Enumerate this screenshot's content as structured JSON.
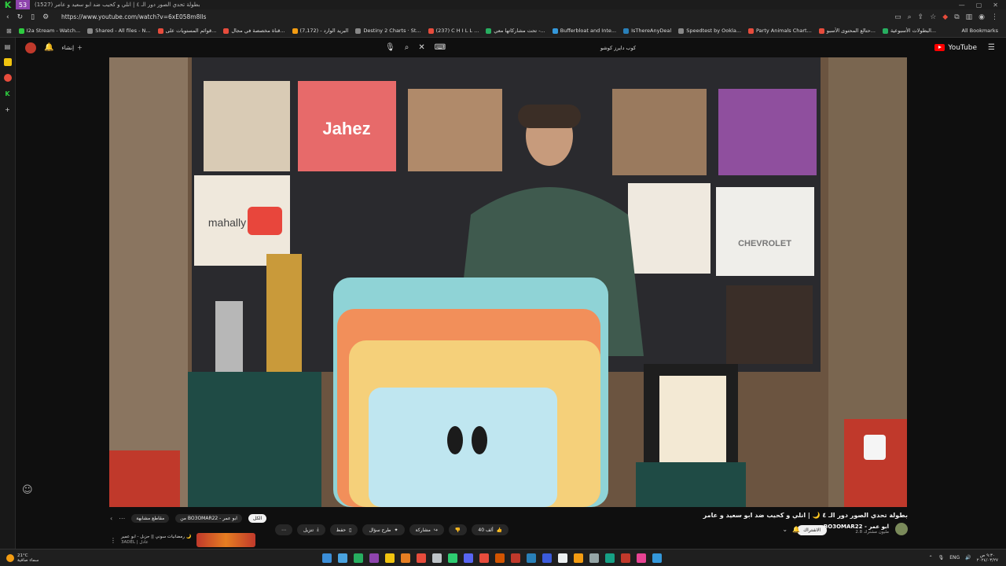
{
  "browser": {
    "tab_title": "(1527) بطولة تحدي الصور دور الـ ٤ | انلي و كحيب ضد ابو سعيد و عامر",
    "url": "https://www.youtube.com/watch?v=6xE058m8lls",
    "bookmarks": [
      {
        "label": "I2a Stream - Watch...",
        "color": "#2ecc40"
      },
      {
        "label": "Shared - All files - N...",
        "color": "#888888"
      },
      {
        "label": "قوائم المستويات على...",
        "color": "#e74c3c"
      },
      {
        "label": "قناة مخصصة في مجال...",
        "color": "#e74c3c"
      },
      {
        "label": "(7,172) - البريد الوارد",
        "color": "#f39c12"
      },
      {
        "label": "Destiny 2 Charts · St...",
        "color": "#888888"
      },
      {
        "label": "(237) C H I L L ...",
        "color": "#e74c3c"
      },
      {
        "label": "تحت مشاركاتها معي -...",
        "color": "#27ae60"
      },
      {
        "label": "Bufferbloat and Inte...",
        "color": "#3498db"
      },
      {
        "label": "IsThereAnyDeal",
        "color": "#2980b9"
      },
      {
        "label": "Speedtest by Ookla...",
        "color": "#888888"
      },
      {
        "label": "Party Animals Chart...",
        "color": "#e74c3c"
      },
      {
        "label": "حتالع المحتوى الأسبو...",
        "color": "#e74c3c"
      },
      {
        "label": "البطولات الأسبوعية...",
        "color": "#27ae60"
      }
    ],
    "all_bookmarks": "All Bookmarks"
  },
  "youtube": {
    "create_label": "إنشاء",
    "search_value": "كوب دايرز كوشو",
    "logo_text": "YouTube",
    "video_title": "بطولة تحدي الصور دور الـ ٤ 🌙 | انلي و كحيب ضد ابو سعيد و عامر",
    "channel_name": "BO3OMAR22 - ابو عمر",
    "subscribers": "2.8 مليون مشترك",
    "subscribe_label": "الاشتراك",
    "like_count": "40 ألف",
    "share_label": "مشاركة",
    "ask_label": "طرح سؤال",
    "save_label": "حفظ",
    "download_label": "تنزيل",
    "chips": [
      {
        "label": "الكل",
        "active": true
      },
      {
        "label": "من BO3OMAR22 - ابو عمر",
        "active": false
      },
      {
        "label": "مقاطع مشابهة",
        "active": false
      }
    ],
    "rec_title": "رمضانيات سوني || حزبل - ابو عمير 🌙",
    "rec_channel": "3ADEL | عادل"
  },
  "taskbar": {
    "temp": "21°C",
    "weather_text": "سماء صافية",
    "lang": "ENG",
    "time": "٩:٣٠ ص",
    "date": "٢٠٢٤/٠٣/٢٧"
  },
  "colors": {
    "youtube_red": "#ff0000",
    "background": "#0f0f0f"
  }
}
